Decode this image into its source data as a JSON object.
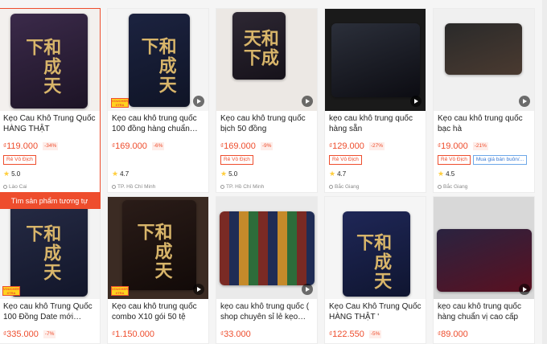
{
  "similar_button_label": "Tìm sản phẩm tương tự",
  "voucher_label": "VOUCHER XTRA",
  "currency_symbol": "₫",
  "colors": {
    "accent": "#ee4d2d",
    "star": "#ffce3d",
    "tag_blue": "#3a7bd5"
  },
  "icons": {
    "play": "play-icon",
    "star": "star-icon",
    "location": "location-pin-icon"
  },
  "products": [
    {
      "title": "Kẹo Cau Khô Trung Quốc HÀNG THẬT",
      "price": "119.000",
      "discount": "-34%",
      "tags": [
        "Rẻ Vô Địch"
      ],
      "rating": "5.0",
      "location": "Lào Cai",
      "hovered": true,
      "video": false,
      "voucher": false
    },
    {
      "title": "Kẹo cau khô trung quốc 100 đồng hàng chuẩn vị...",
      "price": "169.000",
      "discount": "-6%",
      "tags": [],
      "rating": "4.7",
      "location": "TP. Hồ Chí Minh",
      "hovered": false,
      "video": true,
      "voucher": true
    },
    {
      "title": "Kẹo cau khô trung quốc bịch 50 đồng",
      "price": "169.000",
      "discount": "-9%",
      "tags": [
        "Rẻ Vô Địch"
      ],
      "rating": "5.0",
      "location": "TP. Hồ Chí Minh",
      "hovered": false,
      "video": true,
      "voucher": false
    },
    {
      "title": "kẹo cau khô trung quốc hàng sẵn",
      "price": "129.000",
      "discount": "-27%",
      "tags": [
        "Rẻ Vô Địch"
      ],
      "rating": "4.7",
      "location": "Bắc Giang",
      "hovered": false,
      "video": true,
      "voucher": false
    },
    {
      "title": "Kẹo cau khô trung quốc bạc hà",
      "price": "19.000",
      "discount": "-21%",
      "tags": [
        "Rẻ Vô Địch",
        "Mua giá bán buôn/..."
      ],
      "rating": "4.5",
      "location": "Bắc Giang",
      "hovered": false,
      "video": true,
      "voucher": false
    },
    {
      "title": "Kẹo cau khô Trung Quốc 100 Đồng Date mới (Giá...",
      "price": "335.000",
      "discount": "-7%",
      "tags": [],
      "rating": "",
      "location": "",
      "hovered": false,
      "video": false,
      "voucher": true
    },
    {
      "title": "Kẹo cau khô trung quốc combo X10 gói 50 tệ",
      "price": "1.150.000",
      "discount": "",
      "tags": [],
      "rating": "",
      "location": "",
      "hovered": false,
      "video": true,
      "voucher": true
    },
    {
      "title": "kẹo cau khô trung quốc ( shop chuyên sỉ lẻ kẹo ca...",
      "price": "33.000",
      "discount": "",
      "tags": [],
      "rating": "",
      "location": "",
      "hovered": false,
      "video": true,
      "voucher": false
    },
    {
      "title": "Kẹo Cau Khô Trung Quốc HÀNG THẬT '",
      "price": "122.550",
      "discount": "-5%",
      "tags": [],
      "rating": "",
      "location": "",
      "hovered": false,
      "video": false,
      "voucher": false
    },
    {
      "title": "kẹo cau khô trung quốc hàng chuẩn vị cao cấp",
      "price": "89.000",
      "discount": "",
      "tags": [],
      "rating": "",
      "location": "",
      "hovered": false,
      "video": true,
      "voucher": false
    }
  ]
}
